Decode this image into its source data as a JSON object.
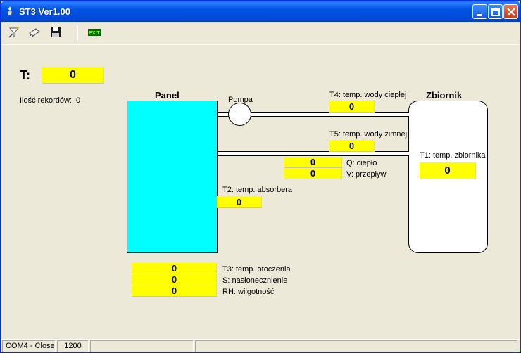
{
  "window": {
    "title": "ST3 Ver1.00"
  },
  "toolbar": {
    "tools": [
      {
        "icon": "funnel-wand-icon"
      },
      {
        "icon": "chip-icon"
      },
      {
        "icon": "floppy-disk-save-icon"
      },
      {
        "icon": "exit-icon",
        "text": "EXIT"
      }
    ]
  },
  "main": {
    "t_label": "T:",
    "t_value": "0",
    "records_label": "Ilość rekordów:",
    "records_count": "0",
    "panel_title": "Panel",
    "tank_title": "Zbiornik",
    "pump_label": "Pompa",
    "t4_label": "T4: temp. wody ciepłej",
    "t4_value": "0",
    "t5_label": "T5: temp. wody zimnej",
    "t5_value": "0",
    "q_label": "Q: ciepło",
    "q_value": "0",
    "v_label": "V: przepływ",
    "v_value": "0",
    "t1_label": "T1: temp. zbiornika",
    "t1_value": "0",
    "t2_label": "T2: temp. absorbera",
    "t2_value": "0",
    "t3_label": "T3: temp. otoczenia",
    "t3_value": "0",
    "s_label": "S: nasłonecznienie",
    "s_value": "0",
    "rh_label": "RH: wilgotność",
    "rh_value": "0"
  },
  "statusbar": {
    "port": "COM4 - Close",
    "baud": "1200"
  },
  "colors": {
    "value_bg": "#ffff00",
    "value_text": "#00008b",
    "panel_fill": "#00ffff",
    "titlebar": "#0055e5"
  }
}
